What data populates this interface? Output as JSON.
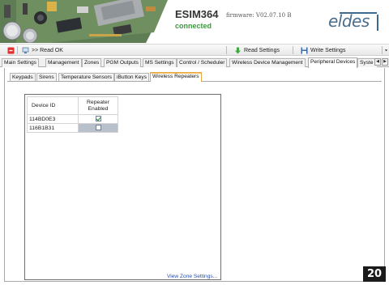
{
  "header": {
    "device_name": "ESIM364",
    "status": "connected",
    "firmware": "firmware: V02.07.10 B",
    "logo_text": "eldes"
  },
  "toolbar": {
    "read_ok_label": ">> Read OK",
    "read_settings_label": "Read Settings",
    "write_settings_label": "Write Settings"
  },
  "main_tabs": [
    {
      "label": "Main Settings"
    },
    {
      "label": "Management"
    },
    {
      "label": "Zones"
    },
    {
      "label": "PGM Outputs"
    },
    {
      "label": "MS Settings"
    },
    {
      "label": "Control / Scheduler"
    },
    {
      "label": "Wireless Device Management"
    },
    {
      "label": "Peripheral Devices",
      "active": true
    },
    {
      "label": "Syste"
    }
  ],
  "sub_tabs": [
    {
      "label": "Keypads"
    },
    {
      "label": "Sirens"
    },
    {
      "label": "Temperature Sensors"
    },
    {
      "label": "iButton Keys"
    },
    {
      "label": "Wireless Repeaters",
      "active": true
    }
  ],
  "grid": {
    "columns": [
      "Device ID",
      "Repeater Enabled"
    ],
    "rows": [
      {
        "device_id": "114BD0E3",
        "repeater_enabled": true
      },
      {
        "device_id": "116B1B31",
        "repeater_enabled": false,
        "selected": true
      }
    ]
  },
  "link": {
    "view_zone_settings": "View Zone Settings..."
  },
  "page_number": "20",
  "colors": {
    "status_green": "#3a9a3a",
    "logo_blue": "#4a6e8c",
    "active_subtab_border": "#e8a640",
    "selected_row": "#b8c0cc"
  }
}
